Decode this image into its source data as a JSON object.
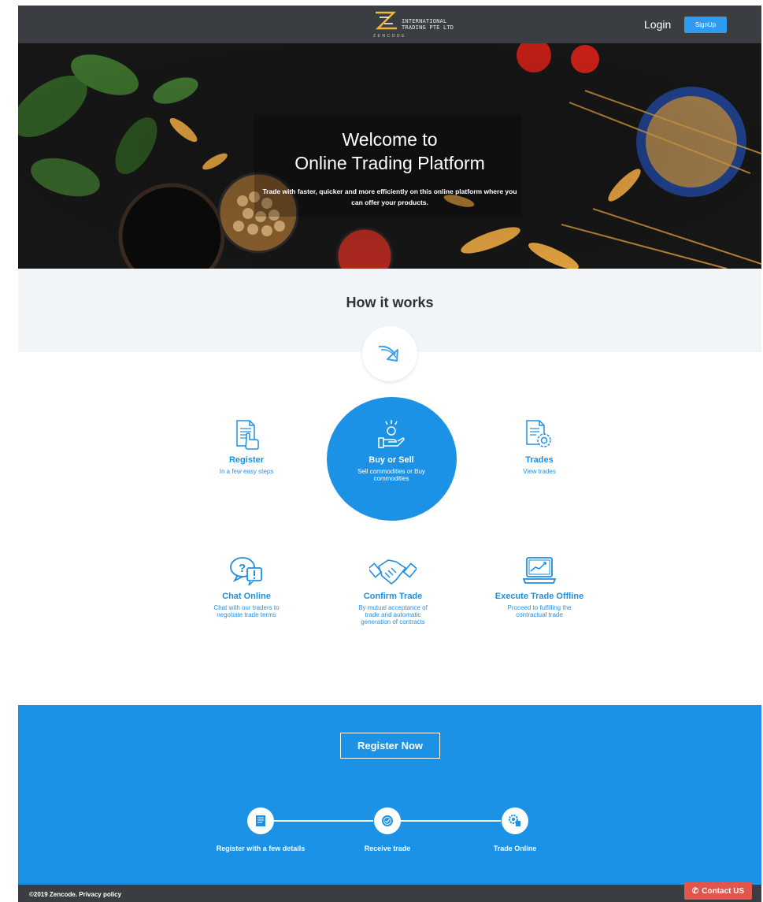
{
  "header": {
    "logo_line1": "INTERNATIONAL",
    "logo_line2": "TRADING PTE LTD",
    "logo_sub": "ZENCODE",
    "login_label": "Login",
    "signup_label": "SignUp"
  },
  "hero": {
    "title_line1": "Welcome to",
    "title_line2": "Online Trading Platform",
    "subtitle": "Trade with faster, quicker and more efficiently on this online platform where you can offer your products."
  },
  "how_it_works": {
    "title": "How it works",
    "features": [
      {
        "title": "Register",
        "desc": "In a few easy steps",
        "icon": "document-hand-icon"
      },
      {
        "title": "Buy or Sell",
        "desc": "Sell commodities or Buy commodities",
        "icon": "hand-offer-icon"
      },
      {
        "title": "Trades",
        "desc": "View trades",
        "icon": "document-gear-icon"
      },
      {
        "title": "Chat Online",
        "desc": "Chat with our traders to negotiate trade terms",
        "icon": "chat-question-icon"
      },
      {
        "title": "Confirm Trade",
        "desc": "By mutual acceptance of trade and automatic generation of contracts",
        "icon": "handshake-icon"
      },
      {
        "title": "Execute Trade Offline",
        "desc": "Proceed to fulfilling the contractual trade",
        "icon": "laptop-chart-icon"
      }
    ]
  },
  "cta": {
    "register_now": "Register Now",
    "steps": [
      {
        "label": "Register with a few details",
        "icon": "form-icon"
      },
      {
        "label": "Receive trade",
        "icon": "badge-check-icon"
      },
      {
        "label": "Trade Online",
        "icon": "gear-dollar-icon"
      }
    ]
  },
  "footer": {
    "copyright": "©2019 Zencode. Privacy policy",
    "contact_label": "Contact US"
  },
  "colors": {
    "primary": "#1b92e6",
    "nav": "#3a3d42",
    "contact": "#e2554c"
  }
}
